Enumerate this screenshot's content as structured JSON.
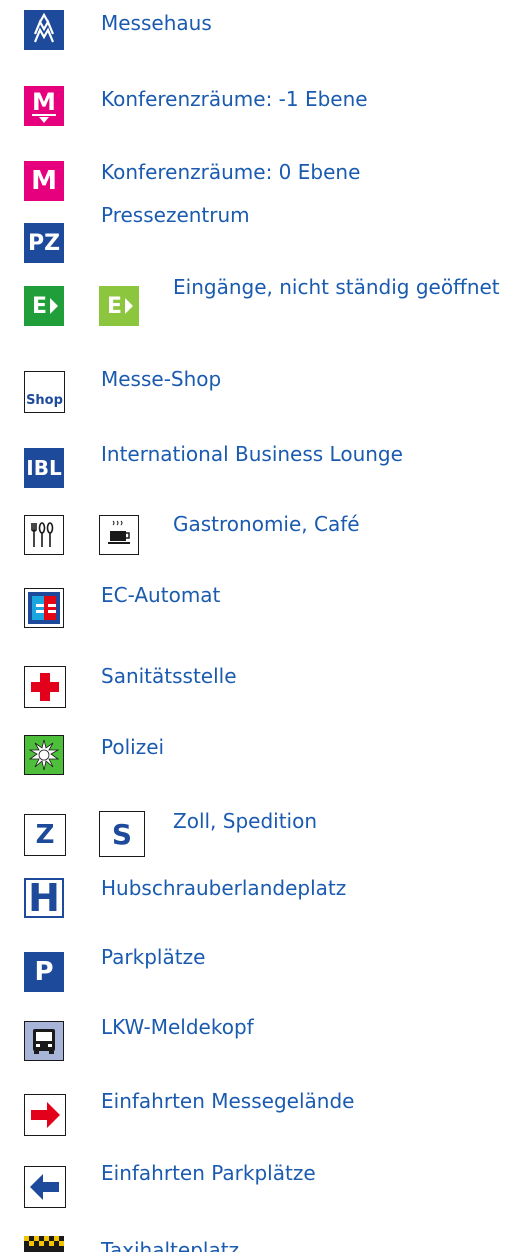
{
  "colors": {
    "label_text": "#1a5bb0",
    "dark_blue": "#1d4a9a",
    "magenta": "#e6007e",
    "green": "#1f9e3a",
    "light_green": "#8cc63f",
    "red": "#e3001b",
    "ec_red": "#e30613",
    "ec_cyan": "#1ba6e0",
    "police_green": "#4dbf3a",
    "truck_bg": "#a8b4d8"
  },
  "legend": {
    "messehaus": {
      "label": "Messehaus",
      "icon": "messe-logo-icon"
    },
    "konf_minus1": {
      "label": "Konferenzräume: -1 Ebene",
      "icon": "M",
      "icon_name": "conference-lower-level-icon"
    },
    "konf_0": {
      "label": "Konferenzräume: 0 Ebene",
      "icon": "M",
      "icon_name": "conference-ground-level-icon"
    },
    "presse": {
      "label": "Pressezentrum",
      "icon": "PZ",
      "icon_name": "press-center-icon"
    },
    "eingaenge": {
      "label": "Eingänge, nicht ständig geöffnet",
      "icon": "E",
      "icon_name": "entrance-icon"
    },
    "shop": {
      "label": "Messe-Shop",
      "icon": "Shop",
      "icon_name": "shop-icon"
    },
    "ibl": {
      "label": "International Business Lounge",
      "icon": "IBL",
      "icon_name": "business-lounge-icon"
    },
    "gastro": {
      "label": "Gastronomie, Café",
      "icon_name": "cutlery-icon"
    },
    "ec": {
      "label": "EC-Automat",
      "icon_name": "ec-atm-icon"
    },
    "sani": {
      "label": "Sanitätsstelle",
      "icon_name": "first-aid-cross-icon"
    },
    "polizei": {
      "label": "Polizei",
      "icon_name": "police-star-icon"
    },
    "zoll": {
      "label": "Zoll, Spedition",
      "icon_z": "Z",
      "icon_s": "S"
    },
    "heli": {
      "label": "Hubschrauberlandeplatz",
      "icon": "H",
      "icon_name": "helipad-icon"
    },
    "park": {
      "label": "Parkplätze",
      "icon": "P",
      "icon_name": "parking-icon"
    },
    "lkw": {
      "label": "LKW-Meldekopf",
      "icon_name": "truck-icon"
    },
    "einfahrt_messe": {
      "label": "Einfahrten Messegelände",
      "icon_name": "red-arrow-right-icon"
    },
    "einfahrt_park": {
      "label": "Einfahrten Parkplätze",
      "icon_name": "blue-arrow-left-icon"
    },
    "taxi": {
      "label": "Taxihalteplatz",
      "icon_name": "taxi-checker-icon"
    }
  }
}
